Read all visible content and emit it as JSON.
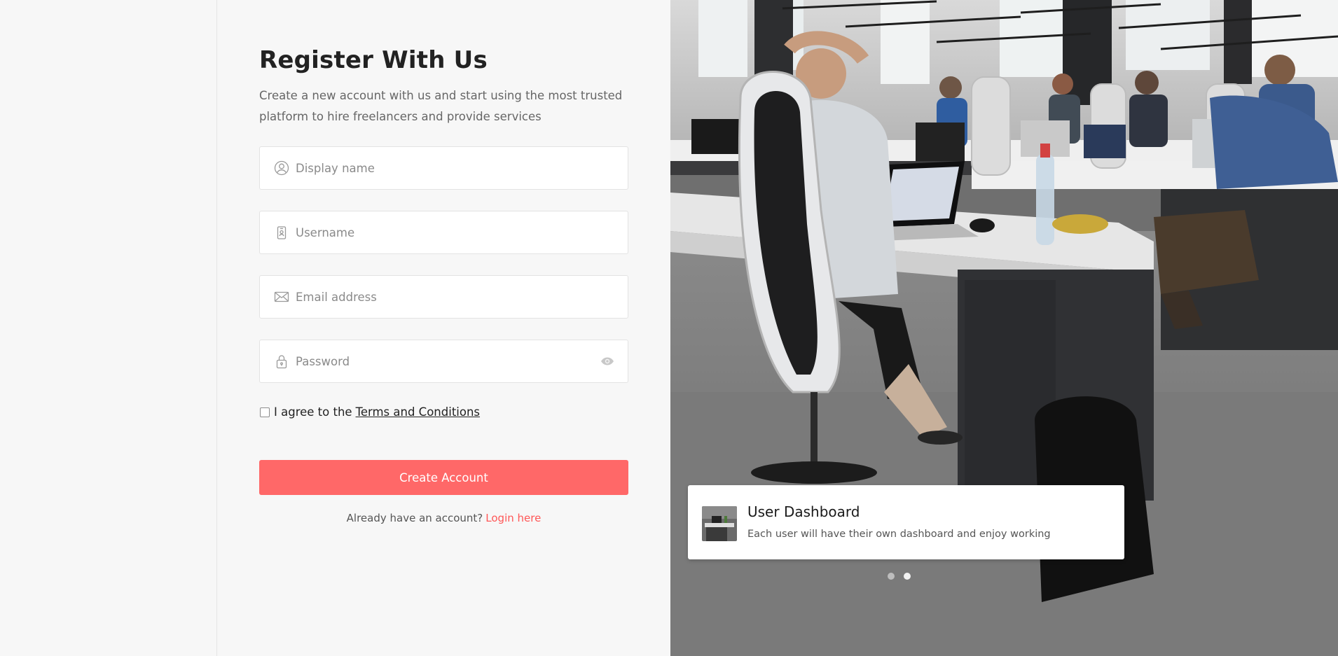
{
  "form": {
    "title": "Register With Us",
    "subtitle": "Create a new account with us and start using the most trusted platform to hire freelancers and provide services",
    "fields": [
      {
        "name": "display-name",
        "placeholder": "Display name",
        "icon": "user-circle-icon"
      },
      {
        "name": "username",
        "placeholder": "Username",
        "icon": "id-badge-icon"
      },
      {
        "name": "email",
        "placeholder": "Email address",
        "icon": "envelope-icon"
      },
      {
        "name": "password",
        "placeholder": "Password",
        "icon": "lock-icon",
        "toggle_icon": "eye-icon"
      }
    ],
    "terms_prefix": "I agree to the",
    "terms_link": "Terms and Conditions",
    "submit_label": "Create Account",
    "login_prompt": "Already have an account?",
    "login_link": "Login here"
  },
  "slider": {
    "card_title": "User Dashboard",
    "card_text": "Each user will have their own dashboard and enjoy working",
    "active_dot": 1,
    "dot_count": 2
  },
  "colors": {
    "accent": "#ff6868",
    "link": "#ff5757",
    "background": "#f7f7f7"
  }
}
